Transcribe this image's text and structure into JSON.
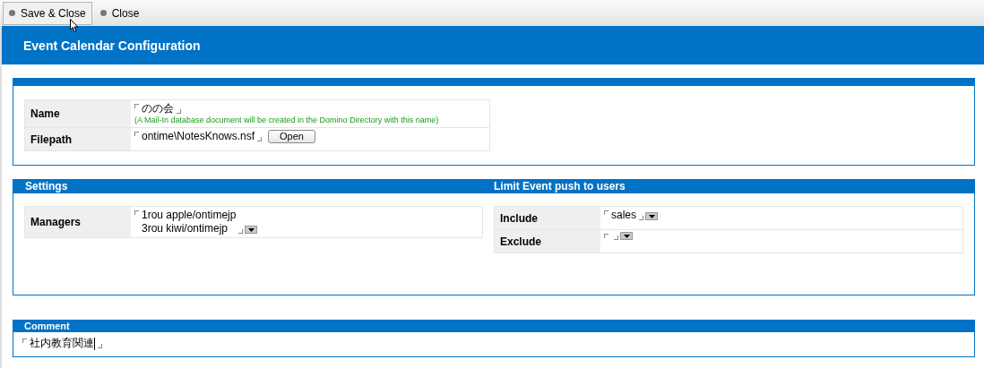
{
  "toolbar": {
    "buttons": [
      {
        "label": "Save & Close",
        "hovered": true
      },
      {
        "label": "Close",
        "hovered": false
      }
    ]
  },
  "header": {
    "title": "Event Calendar Configuration"
  },
  "general": {
    "fields": [
      {
        "label": "Name",
        "lines": [
          "のの会"
        ],
        "note": "(A Mail-In database document will be created in the Domino Directory with this name)"
      },
      {
        "label": "Filepath",
        "lines": [
          "ontime\\NotesKnows.nsf"
        ],
        "button": "Open"
      }
    ]
  },
  "settings": {
    "title": "Settings",
    "fields": [
      {
        "label": "Managers",
        "lines": [
          "1rou apple/ontimejp",
          "3rou kiwi/ontimejp"
        ],
        "dropdown": true
      }
    ]
  },
  "limit": {
    "title": "Limit Event push to users",
    "fields": [
      {
        "label": "Include",
        "lines": [
          "sales"
        ],
        "dropdown": true
      },
      {
        "label": "Exclude",
        "dropdown": true
      }
    ]
  },
  "comment": {
    "title": "Comment",
    "value": "社内教育関連"
  }
}
